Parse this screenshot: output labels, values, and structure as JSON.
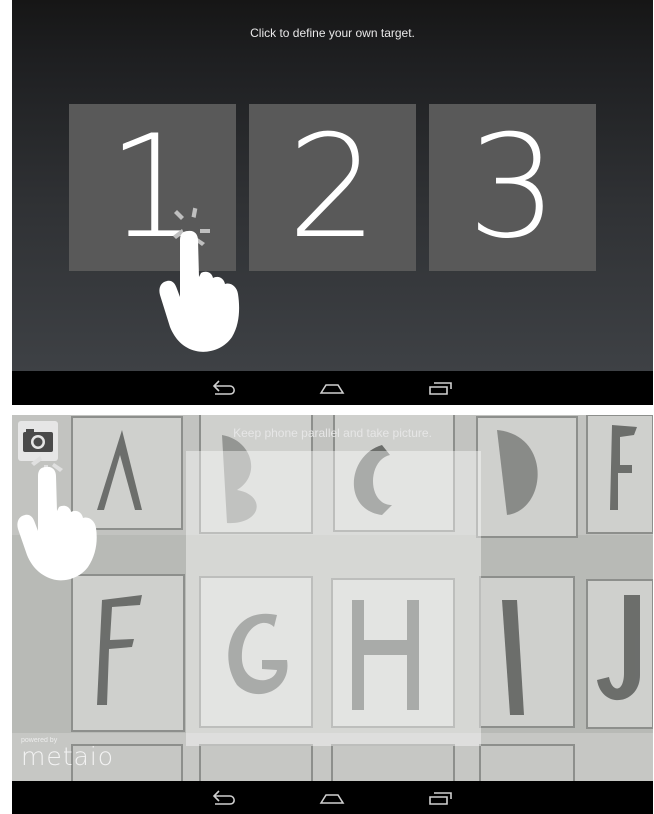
{
  "top": {
    "hint": "Click to define your own target.",
    "tiles": [
      "1",
      "2",
      "3"
    ]
  },
  "bottom": {
    "hint": "Keep phone parallel and take picture.",
    "brand_small": "powered by",
    "brand_name": "metaio",
    "photo_letters": [
      "A",
      "B",
      "C",
      "D",
      "E",
      "F",
      "G",
      "H",
      "I",
      "J"
    ]
  },
  "navbar": {
    "icons": [
      "back-icon",
      "home-icon",
      "recent-apps-icon"
    ]
  },
  "colors": {
    "tile": "#595959",
    "navbar": "#000000"
  }
}
